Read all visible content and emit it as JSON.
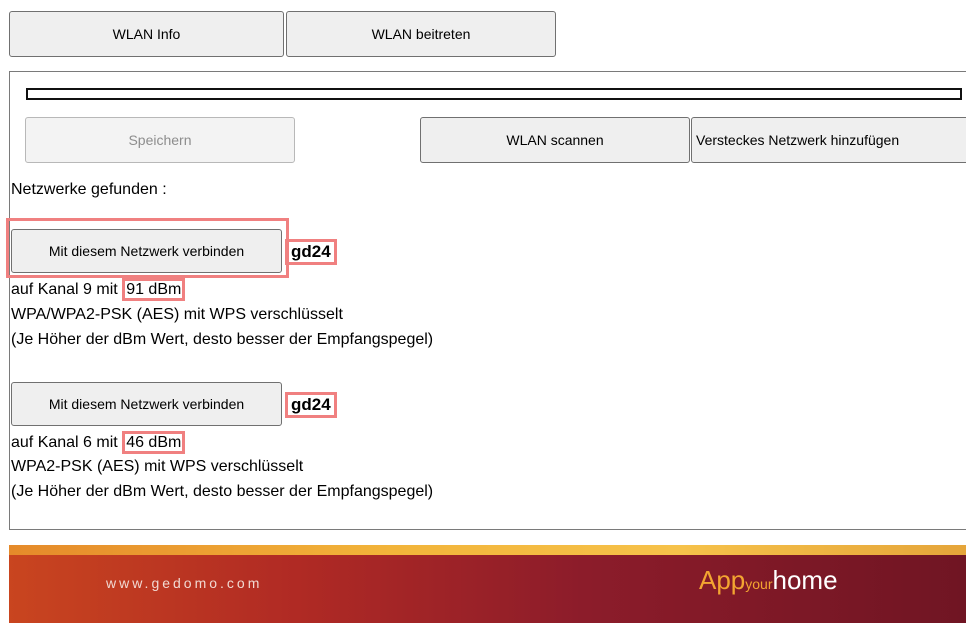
{
  "tabs": {
    "info_label": "WLAN Info",
    "join_label": "WLAN beitreten"
  },
  "actions": {
    "save_label": "Speichern",
    "scan_label": "WLAN scannen",
    "hidden_label": "Versteckes Netzwerk hinzufügen"
  },
  "networks_found_label": "Netzwerke gefunden :",
  "networks": [
    {
      "connect_label": "Mit diesem Netzwerk verbinden",
      "ssid": "gd24",
      "channel_prefix": "auf Kanal 9 mit",
      "signal": "91 dBm",
      "security": "WPA/WPA2-PSK (AES) mit WPS verschlüsselt",
      "hint": "(Je Höher der dBm Wert, desto besser der Empfangspegel)"
    },
    {
      "connect_label": "Mit diesem Netzwerk verbinden",
      "ssid": "gd24",
      "channel_prefix": "auf Kanal 6 mit",
      "signal": "46 dBm",
      "security": "WPA2-PSK (AES) mit WPS verschlüsselt",
      "hint": "(Je Höher der dBm Wert, desto besser der Empfangspegel)"
    }
  ],
  "footer": {
    "website": "www.gedomo.com",
    "brand_app": "App",
    "brand_your": "your",
    "brand_home": "home"
  },
  "colors": {
    "highlight": "#f08080",
    "footer_gradient_start": "#c9451f",
    "footer_gradient_end": "#701523",
    "brand_orange": "#f3a531"
  }
}
